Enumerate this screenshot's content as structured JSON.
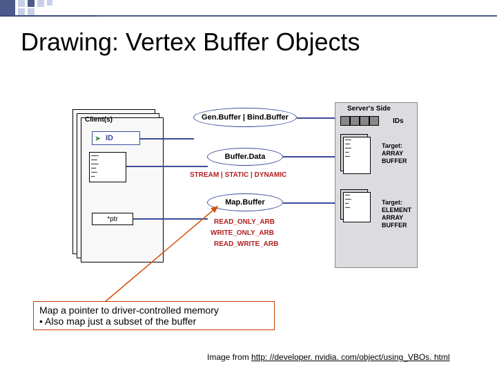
{
  "title": "Drawing:  Vertex Buffer Objects",
  "client": {
    "label": "Client(s)",
    "id_label": "ID",
    "ptr_label": "*ptr"
  },
  "middle": {
    "genbind": "Gen.Buffer | Bind.Buffer",
    "bufferdata": "Buffer.Data",
    "mapbuffer": "Map.Buffer",
    "hints": "STREAM | STATIC | DYNAMIC",
    "read_only": "READ_ONLY_ARB",
    "write_only": "WRITE_ONLY_ARB",
    "read_write": "READ_WRITE_ARB"
  },
  "server": {
    "title": "Server's Side",
    "ids_label": "IDs",
    "target_array": "Target:\nARRAY\nBUFFER",
    "target_element": "Target:\nELEMENT\nARRAY\nBUFFER"
  },
  "caption": {
    "line1": "Map a pointer to driver-controlled memory",
    "line2": "• Also map just a subset of the buffer"
  },
  "credit": {
    "prefix": "Image from ",
    "url_text": "http: //developer. nvidia. com/object/using_VBOs. html"
  }
}
